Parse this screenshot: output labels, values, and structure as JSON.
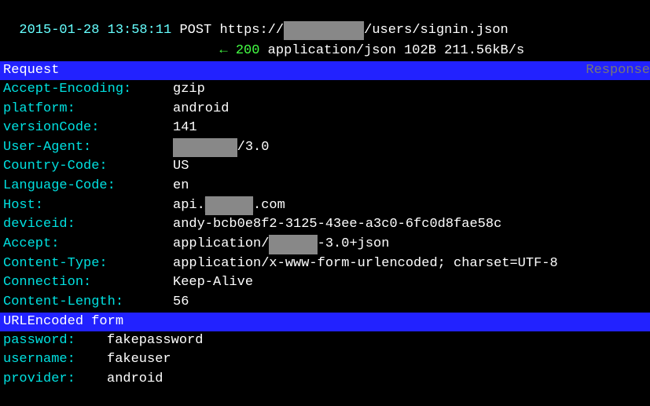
{
  "top": {
    "timestamp": "2015-01-28 13:58:11",
    "method": "POST",
    "urlPrefix": "https://",
    "urlRedacted": "██████████",
    "urlSuffix": "/users/signin.json",
    "status": "200",
    "contentType": "application/json",
    "size": "102B",
    "speed": "211.56kB/s"
  },
  "section1": {
    "left": "Request",
    "right": "Response"
  },
  "headers": [
    {
      "k": "Accept-Encoding:",
      "v": "gzip"
    },
    {
      "k": "platform:",
      "v": "android"
    },
    {
      "k": "versionCode:",
      "v": "141"
    },
    {
      "k": "User-Agent:",
      "pre": "",
      "red": "████████",
      "post": "/3.0"
    },
    {
      "k": "Country-Code:",
      "v": "US"
    },
    {
      "k": "Language-Code:",
      "v": "en"
    },
    {
      "k": "Host:",
      "pre": "api.",
      "red": "██████",
      "post": ".com"
    },
    {
      "k": "deviceid:",
      "v": "andy-bcb0e8f2-3125-43ee-a3c0-6fc0d8fae58c"
    },
    {
      "k": "Accept:",
      "pre": "application/",
      "red": "██████",
      "post": "-3.0+json"
    },
    {
      "k": "Content-Type:",
      "v": "application/x-www-form-urlencoded; charset=UTF-8"
    },
    {
      "k": "Connection:",
      "v": "Keep-Alive"
    },
    {
      "k": "Content-Length:",
      "v": "56"
    }
  ],
  "section2": {
    "left": "URLEncoded form"
  },
  "form": [
    {
      "k": "password:",
      "v": "fakepassword"
    },
    {
      "k": "username:",
      "v": "fakeuser"
    },
    {
      "k": "provider:",
      "v": "android"
    }
  ]
}
